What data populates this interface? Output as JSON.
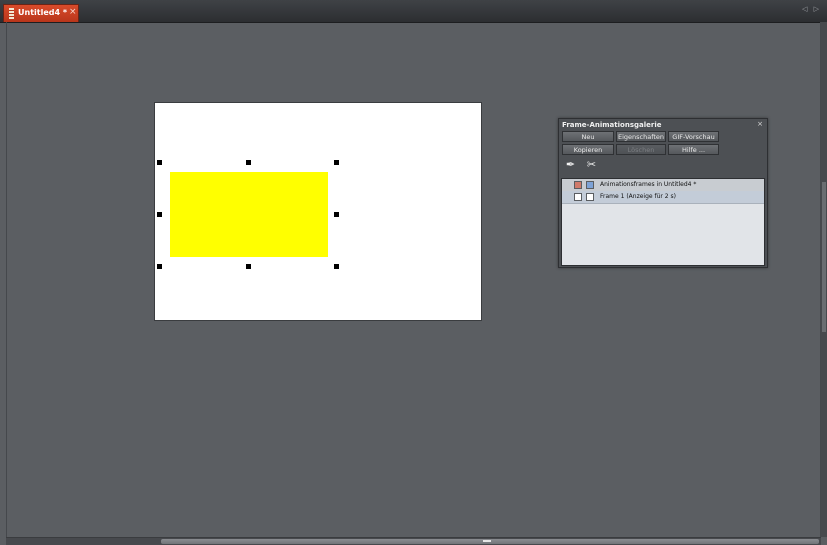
{
  "document_tab": {
    "title": "Untitled4 *",
    "close_symbol": "×",
    "scroll_arrows": "◁ ▷",
    "icon": "document-icon"
  },
  "canvas": {
    "shape_color": "#ffff00",
    "background_color": "#ffffff"
  },
  "animation_panel": {
    "title": "Frame-Animationsgalerie",
    "close_symbol": "×",
    "buttons": {
      "new": "Neu",
      "properties": "Eigenschaften",
      "gif_preview": "GIF-Vorschau",
      "copy": "Kopieren",
      "delete": "Löschen",
      "help": "Hilfe ..."
    },
    "tools": [
      "new-frame-icon",
      "delete-frame-icon"
    ],
    "frames": [
      {
        "label": "Animationsframes in Untitled4 *",
        "type": "root"
      },
      {
        "label": "Frame 1 (Anzeige für 2 s)",
        "type": "frame"
      }
    ]
  },
  "colors": {
    "workspace": "#5b5e62",
    "tab_active": "#d94b2a",
    "panel": "#4d5054"
  }
}
